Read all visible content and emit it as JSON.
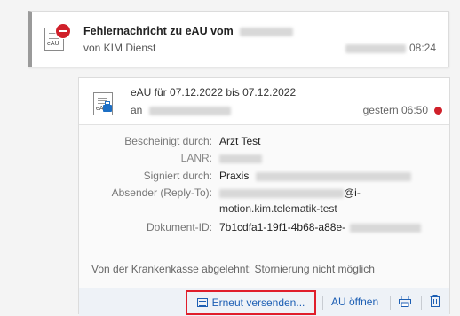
{
  "message": {
    "title": "Fehlernachricht zu eAU vom",
    "from": "von KIM Dienst",
    "time": "08:24",
    "icon": "error-document-icon"
  },
  "detail": {
    "icon_tag": "eAU",
    "title": "eAU für 07.12.2022 bis 07.12.2022",
    "to_prefix": "an",
    "time": "gestern 06:50",
    "fields": {
      "bescheinigt_label": "Bescheinigt durch:",
      "bescheinigt_value": "Arzt Test",
      "lanr_label": "LANR:",
      "signiert_label": "Signiert durch:",
      "signiert_value": "Praxis",
      "absender_label": "Absender (Reply-To):",
      "absender_value_end": "@i-",
      "absender_value_line2": "motion.kim.telematik-test",
      "dokument_label": "Dokument-ID:",
      "dokument_value": "7b1cdfa1-19f1-4b68-a88e-"
    },
    "rejection": "Von der Krankenkasse abgelehnt: Stornierung nicht möglich"
  },
  "toolbar": {
    "resend": "Erneut versenden...",
    "open": "AU öffnen",
    "print_icon": "printer-icon",
    "delete_icon": "trash-icon"
  },
  "colors": {
    "accent": "#1d5fb4",
    "error": "#d0202a",
    "highlight_border": "#e01e2b"
  }
}
